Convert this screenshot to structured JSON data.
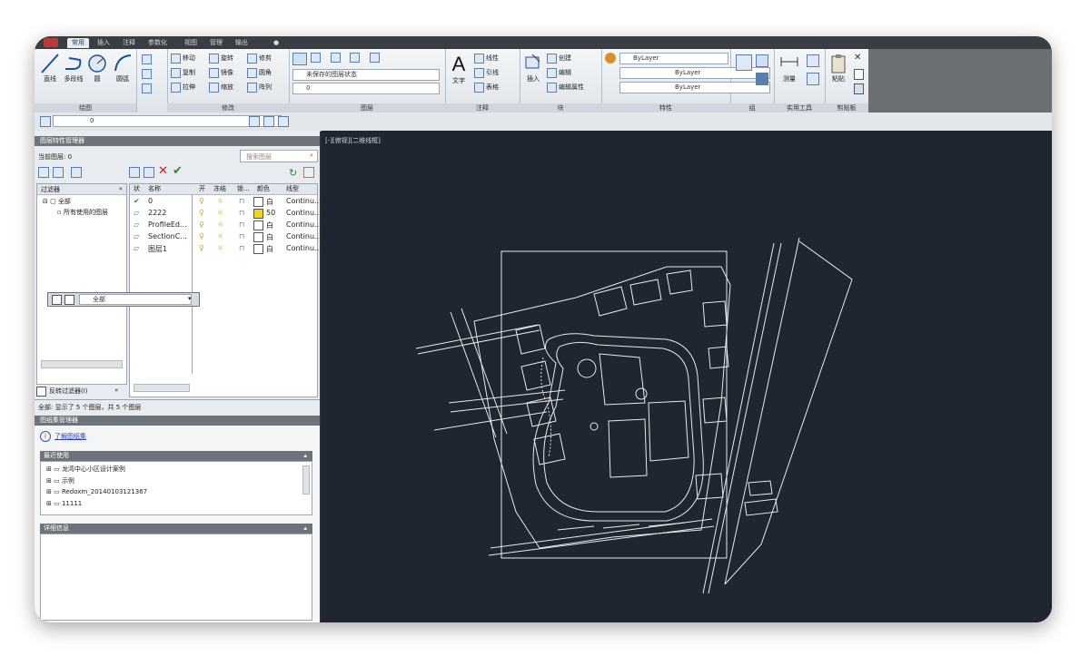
{
  "tabs": [
    "常用",
    "插入",
    "注释",
    "参数化",
    "视图",
    "管理",
    "输出",
    "●"
  ],
  "ribbon": {
    "draw": {
      "line": "直线",
      "polyline": "多段线",
      "circle": "圆",
      "arc": "圆弧",
      "title": "绘图"
    },
    "modify": {
      "move": "移动",
      "rotate": "旋转",
      "trim": "修剪",
      "copy": "复制",
      "mirror": "镜像",
      "fillet": "圆角",
      "stretch": "拉伸",
      "scale": "缩放",
      "array": "阵列",
      "title": "修改"
    },
    "layers": {
      "state": "未保存的图层状态",
      "current": "0",
      "title": "图层"
    },
    "annotation": {
      "text": "文字",
      "linear": "线性",
      "leader": "引线",
      "table": "表格",
      "title": "注释"
    },
    "block": {
      "insert": "插入",
      "create": "创建",
      "edit": "编辑",
      "attribute": "编辑属性",
      "title": "块"
    },
    "properties": {
      "color": "ByLayer",
      "linetype": "ByLayer",
      "lineweight": "ByLayer",
      "title": "特性"
    },
    "groups": {
      "title": "组"
    },
    "utilities": {
      "measure": "测量",
      "title": "实用工具"
    },
    "clipboard": {
      "paste": "粘贴",
      "title": "剪贴板"
    }
  },
  "layer_toolbar": {
    "current": "0"
  },
  "layer_manager": {
    "title": "图层特性管理器",
    "current_layer": "当前图层: 0",
    "search_placeholder": "搜索图层",
    "filter_header": "过滤器",
    "tree_all": "全部",
    "tree_used": "所有使用的图层",
    "invert_filter": "反转过滤器(I)",
    "col_status": "状",
    "col_name": "名称",
    "col_on": "开",
    "col_freeze": "冻结",
    "col_lock": "锁...",
    "col_color": "颜色",
    "col_linetype": "线型",
    "rows": [
      {
        "name": "0",
        "color": "白",
        "linetype": "Continu..."
      },
      {
        "name": "2222",
        "color": "50",
        "linetype": "Continu..."
      },
      {
        "name": "ProfileEd...",
        "color": "白",
        "linetype": "Continu..."
      },
      {
        "name": "SectionC...",
        "color": "白",
        "linetype": "Continu..."
      },
      {
        "name": "图层1",
        "color": "白",
        "linetype": "Continu..."
      }
    ],
    "floating_dd": "全部",
    "status": "全部: 显示了 5 个图层，共 5 个图层"
  },
  "sheet_manager": {
    "title": "图纸集管理器",
    "link": "了解图纸集",
    "recent_header": "最近使用",
    "items": [
      "龙湾中心小区设计案例",
      "示例",
      "Redoxm_20140103121367",
      "11111"
    ],
    "detail_header": "详细信息"
  },
  "viewport": {
    "label": "[-][俯视][二维线框]"
  },
  "colors": {
    "draw_bg": "#1f2630",
    "lines": "#e6e9ee",
    "ribbon_bg": "#e4e8ed"
  }
}
